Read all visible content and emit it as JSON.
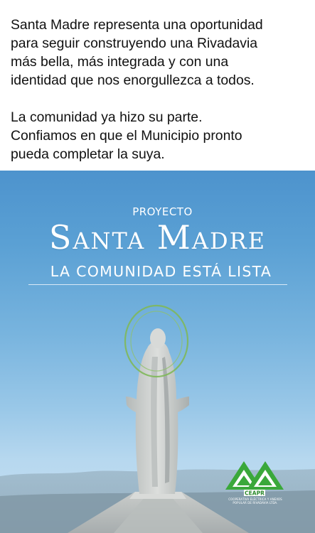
{
  "post": {
    "paragraph1": [
      "Santa Madre representa una oportunidad",
      "para seguir construyendo una Rivadavia",
      "más bella, más integrada y con una",
      "identidad que nos enorgullezca a todos."
    ],
    "paragraph2": [
      "La comunidad ya hizo su parte.",
      "Confiamos en que el Municipio pronto",
      "pueda completar la suya."
    ]
  },
  "poster": {
    "kicker": "PROYECTO",
    "title": "Santa Madre",
    "subtitle": "LA COMUNIDAD ESTÁ LISTA",
    "sky_color": "#5aa0d4",
    "statue_color": "#c9ccc9",
    "halo_color": "#7fb85a"
  },
  "logo": {
    "acronym": "CEAPR",
    "caption_line1": "COOPERATIVA ELÉCTRICA Y ANEXOS",
    "caption_line2": "POPULAR DE RIVADAVIA LTDA.",
    "brand_color": "#3aa83a"
  }
}
